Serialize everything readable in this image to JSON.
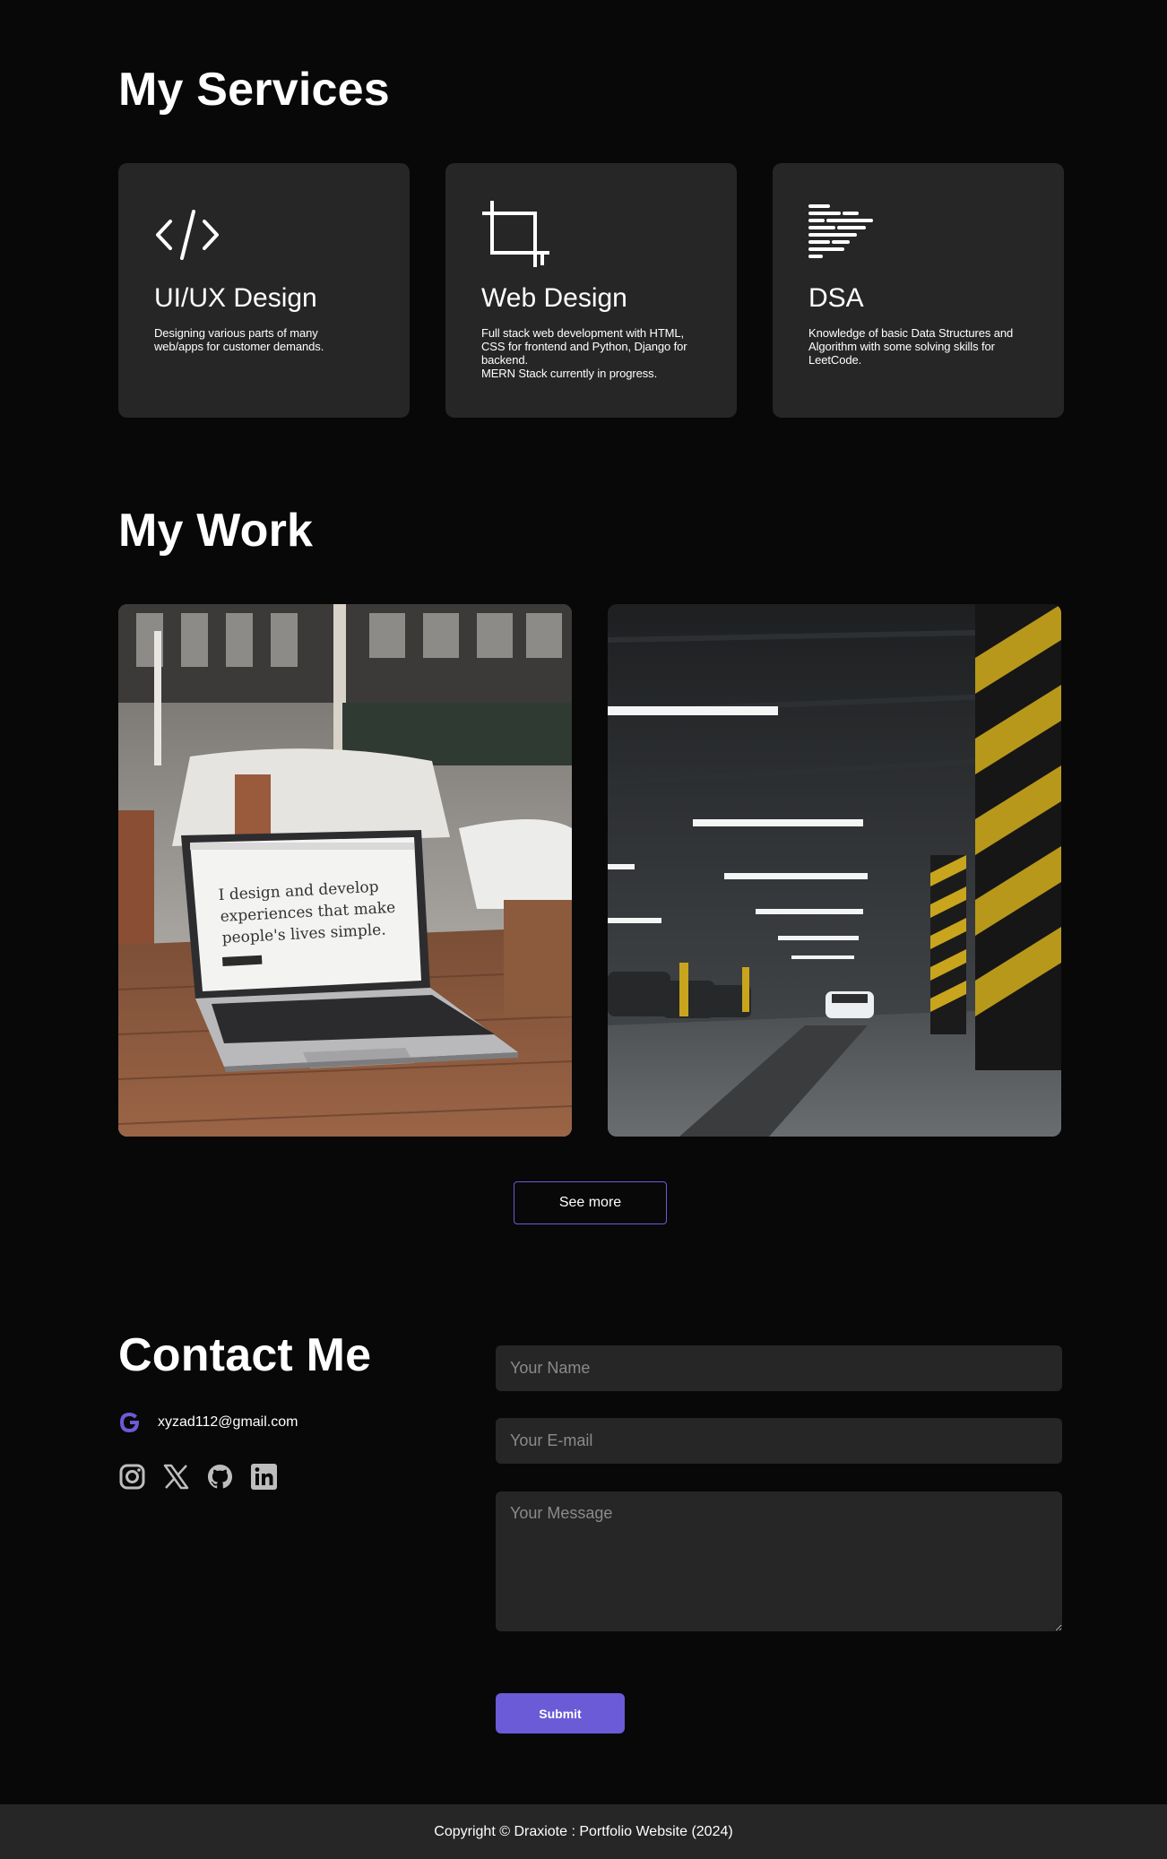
{
  "services": {
    "title": "My Services",
    "items": [
      {
        "icon": "code-icon",
        "title": "UI/UX Design",
        "description": "Designing various parts of many\nweb/apps for customer demands."
      },
      {
        "icon": "crop-icon",
        "title": "Web Design",
        "description": "Full stack web development with HTML,\nCSS for frontend and Python, Django for\nbackend.\nMERN Stack currently in progress."
      },
      {
        "icon": "text-lines-icon",
        "title": "DSA",
        "description": "Knowledge of basic Data Structures and\nAlgorithm with some solving skills for\nLeetCode."
      }
    ]
  },
  "work": {
    "title": "My Work",
    "items": [
      {
        "image": "laptop-on-table-photo",
        "screen_text": [
          "I design and develop",
          "experiences that make",
          "people's lives simple."
        ]
      },
      {
        "image": "parking-garage-photo"
      }
    ],
    "see_more_label": "See more"
  },
  "contact": {
    "title": "Contact Me",
    "email": "xyzad112@gmail.com",
    "email_icon": "google-icon",
    "socials": [
      "instagram-icon",
      "x-icon",
      "github-icon",
      "linkedin-icon"
    ],
    "form": {
      "name_placeholder": "Your Name",
      "email_placeholder": "Your E-mail",
      "message_placeholder": "Your Message",
      "submit_label": "Submit"
    }
  },
  "footer": {
    "text": "Copyright © Draxiote : Portfolio Website (2024)"
  },
  "colors": {
    "background": "#080808",
    "card": "#262626",
    "accent": "#6b5bd6",
    "text": "#ffffff"
  }
}
